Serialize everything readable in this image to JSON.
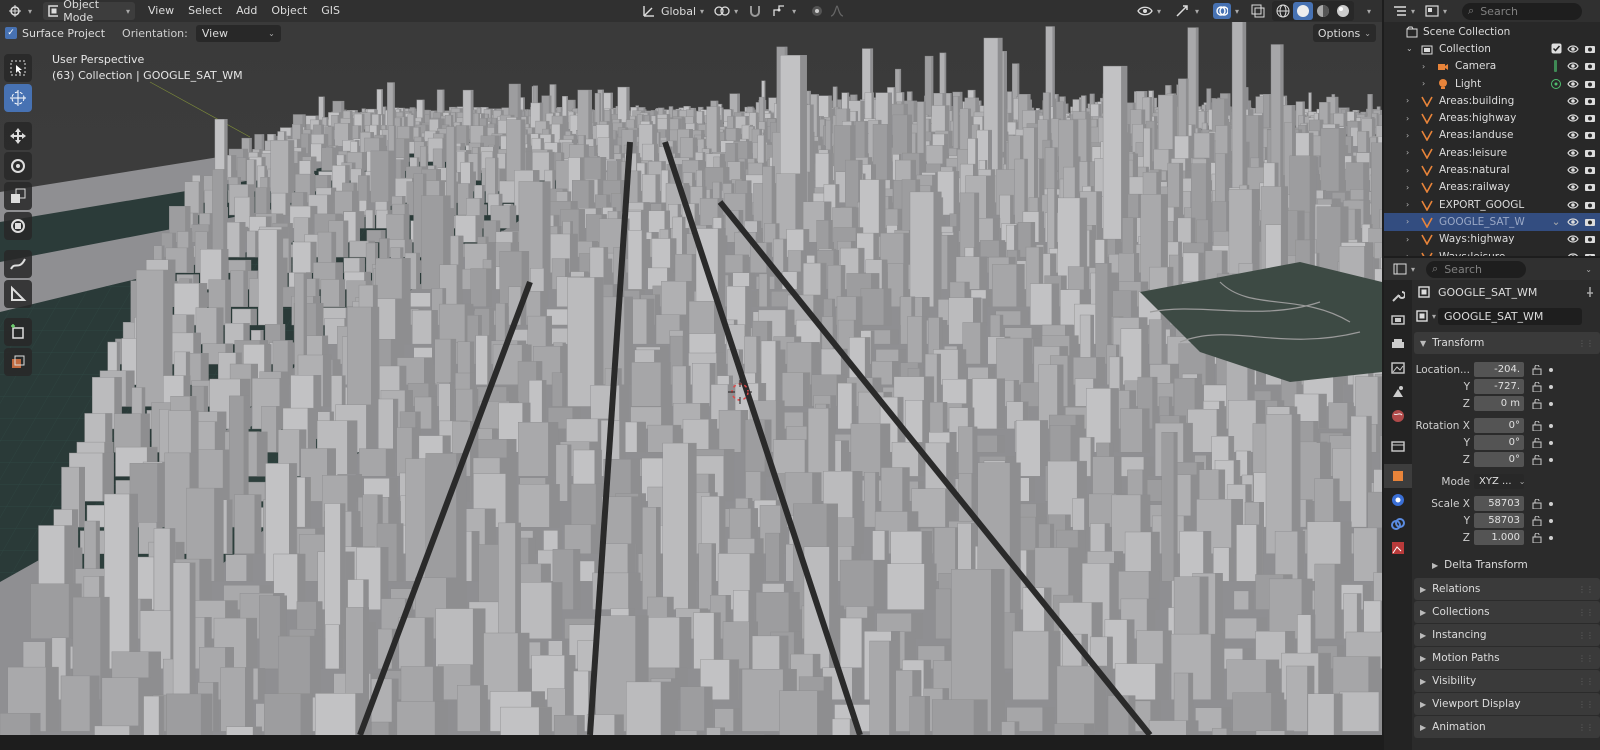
{
  "header": {
    "mode": "Object Mode",
    "menus": [
      "View",
      "Select",
      "Add",
      "Object",
      "GIS"
    ],
    "orientation_global": "Global"
  },
  "subheader": {
    "surface_project": "Surface Project",
    "orientation_label": "Orientation:",
    "orientation_value": "View",
    "options": "Options"
  },
  "viewport": {
    "perspective": "User Perspective",
    "collection_info": "(63) Collection | GOOGLE_SAT_WM"
  },
  "outliner": {
    "search_placeholder": "Search",
    "scene_collection": "Scene Collection",
    "items": [
      {
        "label": "Collection",
        "indent": 1,
        "type": "collection"
      },
      {
        "label": "Camera",
        "indent": 2,
        "type": "camera"
      },
      {
        "label": "Light",
        "indent": 2,
        "type": "light"
      },
      {
        "label": "Areas:building",
        "indent": 1,
        "type": "mesh"
      },
      {
        "label": "Areas:highway",
        "indent": 1,
        "type": "mesh"
      },
      {
        "label": "Areas:landuse",
        "indent": 1,
        "type": "mesh"
      },
      {
        "label": "Areas:leisure",
        "indent": 1,
        "type": "mesh"
      },
      {
        "label": "Areas:natural",
        "indent": 1,
        "type": "mesh"
      },
      {
        "label": "Areas:railway",
        "indent": 1,
        "type": "mesh"
      },
      {
        "label": "EXPORT_GOOGL",
        "indent": 1,
        "type": "mesh"
      },
      {
        "label": "GOOGLE_SAT_W",
        "indent": 1,
        "type": "image",
        "selected": true
      },
      {
        "label": "Ways:highway",
        "indent": 1,
        "type": "mesh"
      },
      {
        "label": "Ways:leisure",
        "indent": 1,
        "type": "mesh"
      }
    ]
  },
  "properties": {
    "search_placeholder": "Search",
    "object_name": "GOOGLE_SAT_WM",
    "object_field": "GOOGLE_SAT_WM",
    "transform_label": "Transform",
    "location_label": "Location...",
    "location": {
      "x": "-204.",
      "y": "-727.",
      "z": "0 m"
    },
    "rotation_label": "Rotation X",
    "rotation": {
      "x": "0°",
      "y": "0°",
      "z": "0°"
    },
    "mode_label": "Mode",
    "mode_value": "XYZ ...",
    "scale_label": "Scale X",
    "scale": {
      "x": "58703",
      "y": "58703",
      "z": "1.000"
    },
    "axis_y": "Y",
    "axis_z": "Z",
    "delta_transform": "Delta Transform",
    "panels": [
      "Relations",
      "Collections",
      "Instancing",
      "Motion Paths",
      "Visibility",
      "Viewport Display",
      "Animation"
    ]
  },
  "colors": {
    "accent": "#4772b3",
    "selected_row": "#334d80",
    "header_bg": "#303030",
    "panel_bg": "#2b2b2b",
    "building": "#a9a9ab",
    "water": "#2a3a38"
  }
}
